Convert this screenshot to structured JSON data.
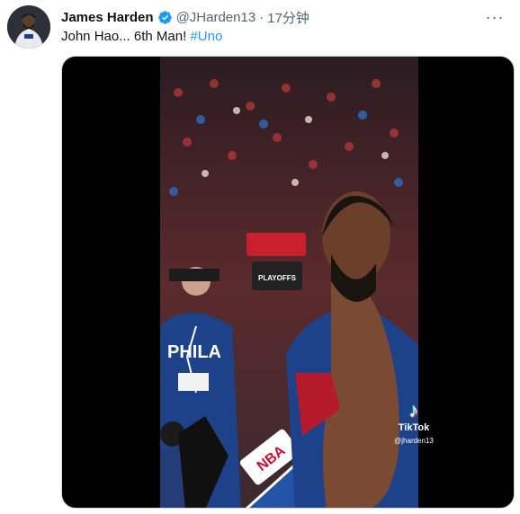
{
  "tweet": {
    "author_name": "James Harden",
    "handle": "@JHarden13",
    "separator": "·",
    "time": "17分钟",
    "text": "John Hao... 6th Man!",
    "hashtag": "#Uno",
    "more_label": "···"
  },
  "video": {
    "watermark_brand": "TikTok",
    "watermark_user": "@jharden13",
    "jersey_text": "PHILA",
    "banner_text": "PLAYOFFS",
    "court_logo": "NBA"
  },
  "colors": {
    "link": "#1d9bf0",
    "verified": "#1d9bf0",
    "secondary_text": "#536471"
  }
}
